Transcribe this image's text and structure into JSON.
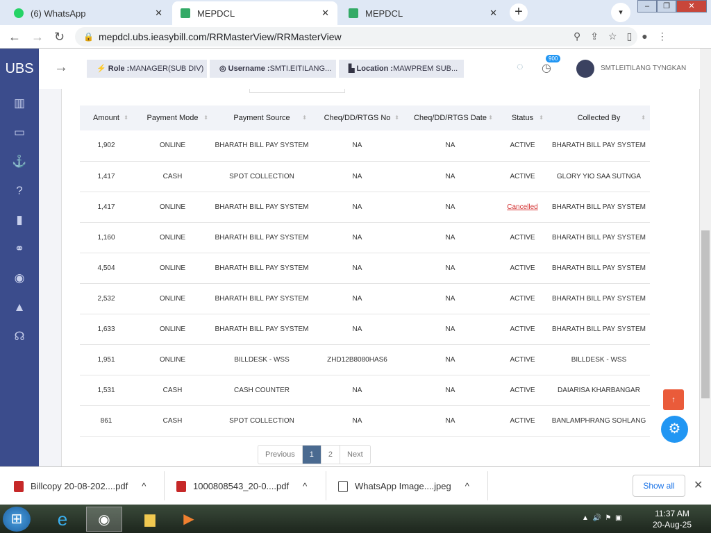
{
  "browser": {
    "tabs": [
      {
        "title": "(6) WhatsApp"
      },
      {
        "title": "MEPDCL"
      },
      {
        "title": "MEPDCL"
      }
    ],
    "url": "mepdcl.ubs.ieasybill.com/RRMasterView/RRMasterView"
  },
  "app": {
    "logo": "UBS",
    "role_label": "Role :",
    "role": "MANAGER(SUB DIV)",
    "username_label": "Username :",
    "username": "SMTI.EITILANG...",
    "location_label": "Location :",
    "location": "MAWPREM SUB...",
    "notif_count": "900",
    "user_name": "SMTLEITILANG TYNGKAN"
  },
  "table": {
    "headers": [
      "Amount",
      "Payment Mode",
      "Payment Source",
      "Cheq/DD/RTGS No",
      "Cheq/DD/RTGS Date",
      "Status",
      "Collected By"
    ],
    "rows": [
      [
        "1,902",
        "ONLINE",
        "BHARATH BILL PAY SYSTEM",
        "NA",
        "NA",
        "ACTIVE",
        "BHARATH BILL PAY SYSTEM"
      ],
      [
        "1,417",
        "CASH",
        "SPOT COLLECTION",
        "NA",
        "NA",
        "ACTIVE",
        "GLORY YIO SAA SUTNGA"
      ],
      [
        "1,417",
        "ONLINE",
        "BHARATH BILL PAY SYSTEM",
        "NA",
        "NA",
        "Cancelled",
        "BHARATH BILL PAY SYSTEM"
      ],
      [
        "1,160",
        "ONLINE",
        "BHARATH BILL PAY SYSTEM",
        "NA",
        "NA",
        "ACTIVE",
        "BHARATH BILL PAY SYSTEM"
      ],
      [
        "4,504",
        "ONLINE",
        "BHARATH BILL PAY SYSTEM",
        "NA",
        "NA",
        "ACTIVE",
        "BHARATH BILL PAY SYSTEM"
      ],
      [
        "2,532",
        "ONLINE",
        "BHARATH BILL PAY SYSTEM",
        "NA",
        "NA",
        "ACTIVE",
        "BHARATH BILL PAY SYSTEM"
      ],
      [
        "1,633",
        "ONLINE",
        "BHARATH BILL PAY SYSTEM",
        "NA",
        "NA",
        "ACTIVE",
        "BHARATH BILL PAY SYSTEM"
      ],
      [
        "1,951",
        "ONLINE",
        "BILLDESK - WSS",
        "ZHD12B8080HAS6",
        "NA",
        "ACTIVE",
        "BILLDESK - WSS"
      ],
      [
        "1,531",
        "CASH",
        "CASH COUNTER",
        "NA",
        "NA",
        "ACTIVE",
        "DAIARISA KHARBANGAR"
      ],
      [
        "861",
        "CASH",
        "SPOT COLLECTION",
        "NA",
        "NA",
        "ACTIVE",
        "BANLAMPHRANG SOHLANG"
      ]
    ]
  },
  "pagination": {
    "prev": "Previous",
    "pages": [
      "1",
      "2"
    ],
    "next": "Next",
    "current": "1"
  },
  "downloads": {
    "items": [
      "Billcopy 20-08-202....pdf",
      "1000808543_20-0....pdf",
      "WhatsApp Image....jpeg"
    ],
    "show_all": "Show all"
  },
  "taskbar": {
    "time": "11:37 AM",
    "date": "20-Aug-25"
  }
}
